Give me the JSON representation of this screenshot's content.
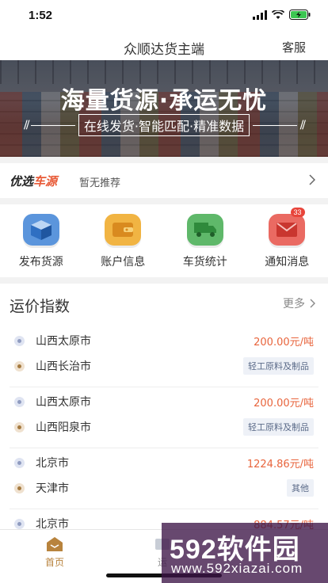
{
  "status_bar": {
    "time": "1:52"
  },
  "nav": {
    "title": "众顺达货主端",
    "service": "客服"
  },
  "banner": {
    "headline": "海量货源·承运无忧",
    "subline": "在线发货·智能匹配·精准数据",
    "slashes_left": "//",
    "slashes_right": "//"
  },
  "preferred": {
    "logo_a": "优选",
    "logo_b": "车源",
    "text": "暂无推荐"
  },
  "quick_actions": [
    {
      "label": "发布货源",
      "icon": "cube-icon",
      "color": "#3b7fd6"
    },
    {
      "label": "账户信息",
      "icon": "wallet-icon",
      "color": "#e9a431"
    },
    {
      "label": "车货统计",
      "icon": "truck-icon",
      "color": "#4daa57"
    },
    {
      "label": "通知消息",
      "icon": "mail-icon",
      "color": "#e2524a",
      "badge": "33"
    }
  ],
  "freight": {
    "title": "运价指数",
    "more": "更多",
    "routes": [
      {
        "from": "山西太原市",
        "to": "山西长治市",
        "price": "200.00元/吨",
        "tag": "轻工原料及制品"
      },
      {
        "from": "山西太原市",
        "to": "山西阳泉市",
        "price": "200.00元/吨",
        "tag": "轻工原料及制品"
      },
      {
        "from": "北京市",
        "to": "天津市",
        "price": "1224.86元/吨",
        "tag": "其他"
      },
      {
        "from": "北京市",
        "to": "",
        "price": "884.57元/吨",
        "tag": ""
      }
    ]
  },
  "tabbar": {
    "home": "首页",
    "second": "运"
  },
  "watermark": {
    "big": "592软件园",
    "small": "www.592xiazai.com"
  }
}
